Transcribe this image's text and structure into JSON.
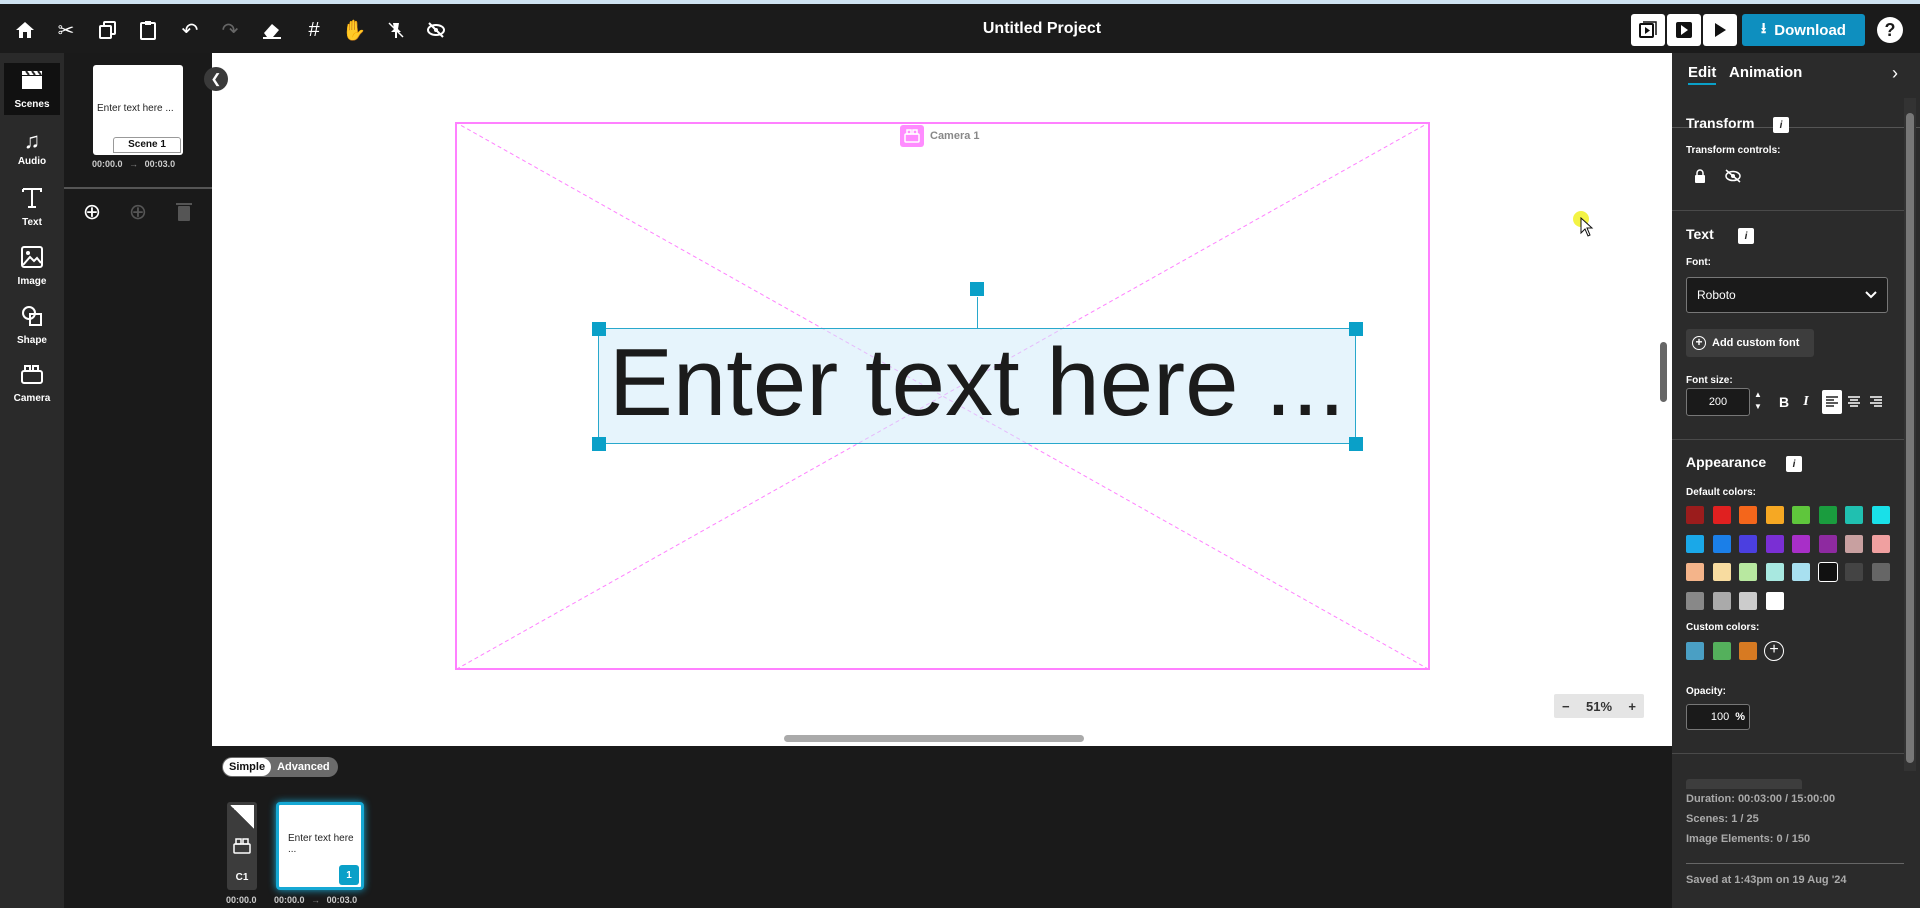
{
  "topbar": {
    "title": "Untitled Project",
    "download_label": "Download",
    "help_label": "?",
    "tools": [
      "home-icon",
      "scissors-icon",
      "copy-icon",
      "paste-icon",
      "undo-icon",
      "redo-icon",
      "eraser-icon",
      "grid-icon",
      "hand-icon",
      "pin-icon",
      "eye-off-icon"
    ]
  },
  "leftnav": {
    "items": [
      {
        "label": "Scenes",
        "icon": "clapper-icon"
      },
      {
        "label": "Audio",
        "icon": "music-icon"
      },
      {
        "label": "Text",
        "icon": "text-icon"
      },
      {
        "label": "Image",
        "icon": "image-icon"
      },
      {
        "label": "Shape",
        "icon": "shape-icon"
      },
      {
        "label": "Camera",
        "icon": "camera-icon"
      }
    ]
  },
  "scenes_panel": {
    "card_text": "Enter text here ...",
    "card_label": "Scene 1",
    "start": "00:00.0",
    "arrow": "→",
    "end": "00:03.0"
  },
  "canvas": {
    "camera_label": "Camera 1",
    "text": "Enter text here ...",
    "zoom_minus": "−",
    "zoom": "51%",
    "zoom_plus": "+"
  },
  "timeline": {
    "mode_simple": "Simple",
    "mode_advanced": "Advanced",
    "camera_track_label": "C1",
    "camera_time": "00:00.0",
    "scene_text": "Enter text here ...",
    "scene_number": "1",
    "scene_start": "00:00.0",
    "arrow": "→",
    "scene_end": "00:03.0"
  },
  "rightpanel": {
    "tabs": [
      "Edit",
      "Animation"
    ],
    "transform_title": "Transform",
    "transform_controls_label": "Transform controls:",
    "text_title": "Text",
    "font_label": "Font:",
    "font_value": "Roboto",
    "add_custom_font": "Add custom font",
    "font_size_label": "Font size:",
    "font_size": "200",
    "bold": "B",
    "italic": "I",
    "appearance_title": "Appearance",
    "default_colors_label": "Default colors:",
    "default_colors": [
      "#9b1c1c",
      "#e02020",
      "#f4661b",
      "#f6a823",
      "#5fc63c",
      "#1a9c3e",
      "#20c0b0",
      "#19e0e8",
      "#1aa8e8",
      "#1b7fe8",
      "#4b3fe0",
      "#7a2fd4",
      "#a82fc8",
      "#8e2aa0",
      "#c8a0a0",
      "#f0a0a0",
      "#f4b48a",
      "#f8dca0",
      "#b8e8a0",
      "#a8e8e0",
      "#a8e0f0",
      "#111111",
      "#444444",
      "#666666",
      "#888888",
      "#aaaaaa",
      "#cccccc",
      "#ffffff"
    ],
    "custom_colors_label": "Custom colors:",
    "custom_colors": [
      "#4a9fc4",
      "#54b05c",
      "#d77a22"
    ],
    "opacity_label": "Opacity:",
    "opacity": "100",
    "opacity_unit": "%",
    "footer": {
      "duration": "Duration: 00:03:00 / 15:00:00",
      "scenes": "Scenes: 1 / 25",
      "image_elements": "Image Elements: 0 / 150",
      "saved": "Saved at 1:43pm on 19 Aug '24"
    }
  }
}
